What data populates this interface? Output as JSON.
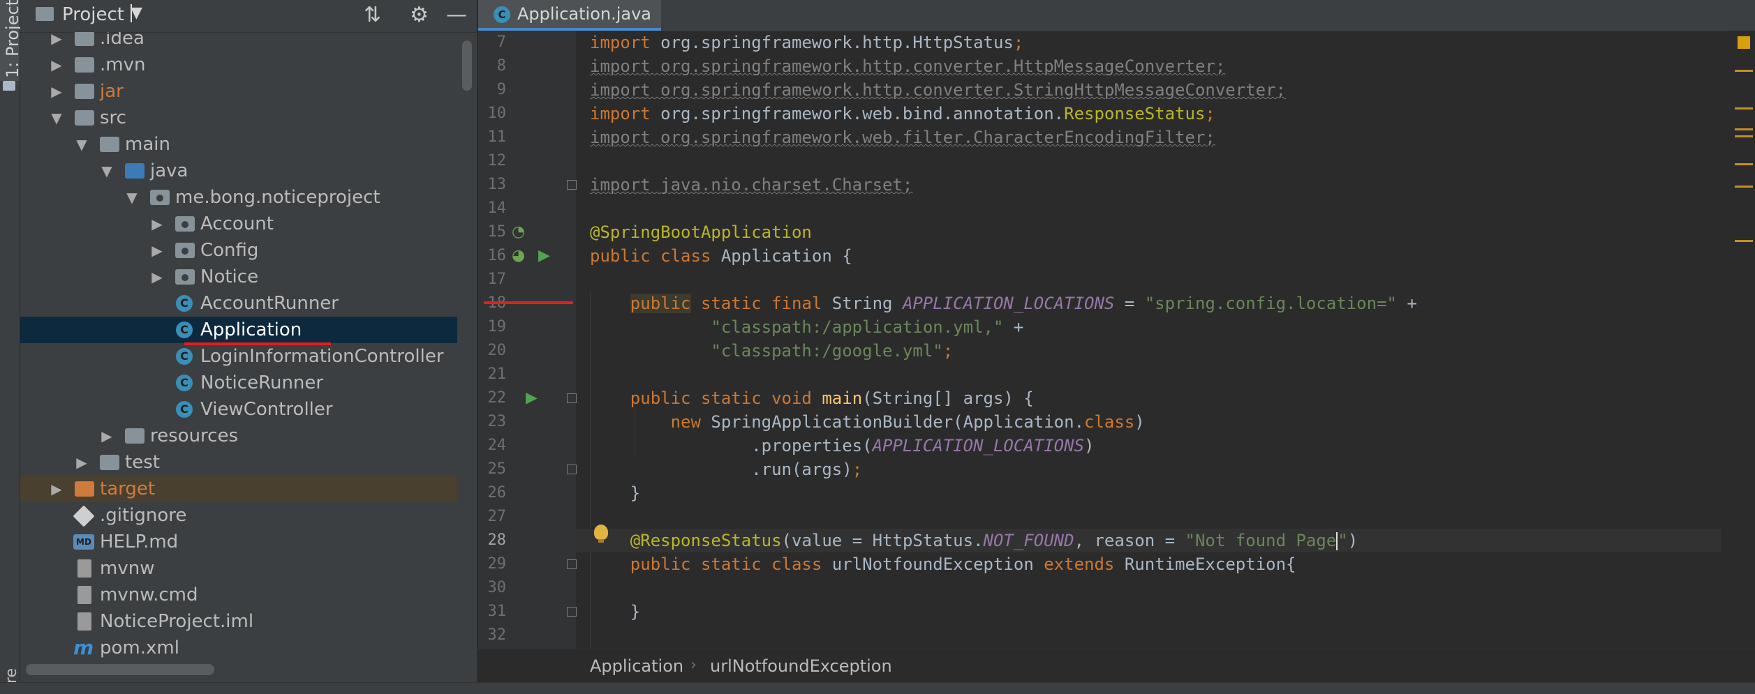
{
  "toolstrip": {
    "project_tab": "1: Project",
    "structure_tab": "ure"
  },
  "project_panel": {
    "title": "Project",
    "tree": [
      {
        "label": "idea_placeholder"
      }
    ]
  },
  "tree": {
    "idea": ".idea",
    "mvn": ".mvn",
    "jar": "jar",
    "src": "src",
    "main": "main",
    "java": "java",
    "pkg": "me.bong.noticeproject",
    "account": "Account",
    "config": "Config",
    "notice": "Notice",
    "accountrunner": "AccountRunner",
    "application": "Application",
    "logininfo": "LoginInformationController",
    "noticerunner": "NoticeRunner",
    "viewcontroller": "ViewController",
    "resources": "resources",
    "test": "test",
    "target": "target",
    "gitignore": ".gitignore",
    "helpmd": "HELP.md",
    "mvnw": "mvnw",
    "mvnwcmd": "mvnw.cmd",
    "iml": "NoticeProject.iml",
    "pom": "pom.xml",
    "md_badge": "MD",
    "class_badge": "C",
    "maven_badge": "m"
  },
  "editor": {
    "tab_label": "Application.java",
    "line_numbers": [
      "7",
      "8",
      "9",
      "10",
      "11",
      "12",
      "13",
      "14",
      "15",
      "16",
      "17",
      "18",
      "19",
      "20",
      "21",
      "22",
      "23",
      "24",
      "25",
      "26",
      "27",
      "28",
      "29",
      "30",
      "31",
      "32"
    ],
    "breadcrumb": [
      "Application",
      "urlNotfoundException"
    ],
    "breadcrumb_sep": "›"
  },
  "code": {
    "l7_kw": "import",
    "l7_rest": " org.springframework.http.HttpStatus",
    "l7_semi": ";",
    "l8": "import org.springframework.http.converter.HttpMessageConverter;",
    "l9": "import org.springframework.http.converter.StringHttpMessageConverter;",
    "l10_kw": "import",
    "l10_a": " org.springframework.web.bind.annotation.",
    "l10_ann": "ResponseStatus",
    "l10_semi": ";",
    "l11": "import org.springframework.web.filter.CharacterEncodingFilter;",
    "l13": "import java.nio.charset.Charset;",
    "l15": "@SpringBootApplication",
    "l16_kw": "public class",
    "l16_rest": " Application {",
    "l18_kw1": "public",
    "l18_kw2": " static final",
    "l18_type": " String ",
    "l18_const": "APPLICATION_LOCATIONS",
    "l18_eq": " = ",
    "l18_str": "\"spring.config.location=\"",
    "l18_plus": " +",
    "l19_str": "\"classpath:/application.yml,\"",
    "l19_plus": " +",
    "l20_str": "\"classpath:/google.yml\"",
    "l20_semi": ";",
    "l22_kw": "public static void",
    "l22_name": " main",
    "l22_rest": "(String[] args) {",
    "l23_kw": "new",
    "l23_a": " SpringApplicationBuilder(Application.",
    "l23_kw2": "class",
    "l23_b": ")",
    "l24_a": ".properties(",
    "l24_const": "APPLICATION_LOCATIONS",
    "l24_b": ")",
    "l25_a": ".run(args)",
    "l25_semi": ";",
    "l26": "}",
    "l28_ann": "@ResponseStatus",
    "l28_a": "(value = HttpStatus.",
    "l28_const": "NOT_FOUND",
    "l28_b": ", reason = ",
    "l28_str1": "\"Not found Page",
    "l28_str2": "\"",
    "l28_c": ")",
    "l29_kw": "public static class",
    "l29_a": " urlNotfoundException ",
    "l29_kw2": "extends",
    "l29_b": " RuntimeException{",
    "l31": "}"
  },
  "colors": {
    "keyword": "#cc7832",
    "annotation": "#bbb529",
    "string": "#6a8759",
    "constant": "#9876aa",
    "selection": "#0d293e",
    "highlight_underline": "#e02020"
  },
  "icons": [
    "folder-icon",
    "chevron-down-icon",
    "collapse-all-icon",
    "gear-icon",
    "minimize-icon",
    "class-icon",
    "run-icon",
    "fold-icon",
    "lightbulb-icon",
    "spring-bean-icon"
  ]
}
